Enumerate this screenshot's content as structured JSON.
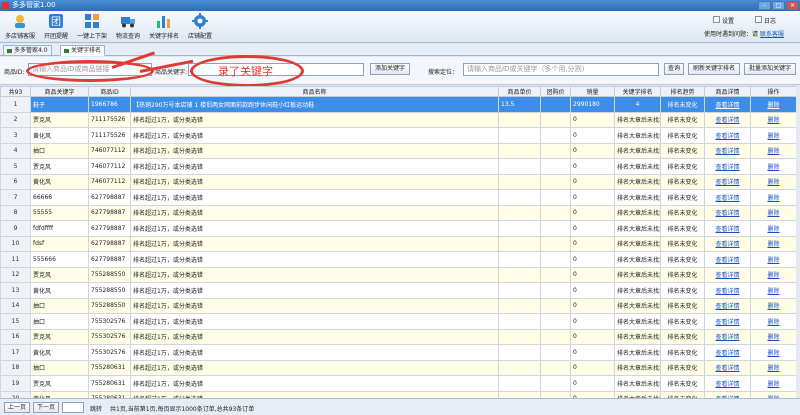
{
  "window": {
    "title": "多多管家1.00"
  },
  "toolbar": {
    "items": [
      {
        "label": "多店铺客服",
        "icon": "shop-service-icon"
      },
      {
        "label": "开团提醒",
        "icon": "group-buy-icon"
      },
      {
        "label": "一键上下架",
        "icon": "shelf-grid-icon"
      },
      {
        "label": "物流查询",
        "icon": "truck-icon"
      },
      {
        "label": "关键字排名",
        "icon": "bar-chart-icon"
      },
      {
        "label": "店铺配置",
        "icon": "gear-icon"
      }
    ],
    "settings_label": "设置",
    "log_label": "日志",
    "usage_text": "使用时遇到问题：请",
    "usage_link": "联系客服"
  },
  "tabs": [
    {
      "label": "多多管家4.0",
      "active": false
    },
    {
      "label": "关键字排名",
      "active": true
    }
  ],
  "search": {
    "product_id_label": "商品ID:",
    "product_id_placeholder": "请输入商品ID或商品链接",
    "keyword_label": "商品关键字:",
    "keyword_value": "",
    "add_keyword_button": "添加关键字",
    "search_locate_label": "搜索定位：",
    "search_placeholder": "请输入商品ID或关键字（多个用,分割)",
    "query_button": "查询",
    "refresh_rank_button": "刷新关键字排名",
    "batch_add_button": "批量添加关键字"
  },
  "annotation": {
    "text": "录了关键字"
  },
  "table": {
    "count_label": "共93",
    "columns": [
      "商品关键字",
      "商品ID",
      "商品名称",
      "商品单价",
      "团购价",
      "销量",
      "关键字排名",
      "排名趋势",
      "商品详情",
      "操作"
    ],
    "rows": [
      {
        "n": "1",
        "kw": "鞋子",
        "id": "1966786",
        "name": "【热销290万号本店铺 1 楼侣两女网面前款跑步休闲鞋小红板运动鞋",
        "price": "13.5",
        "group": "",
        "sales": "2990180",
        "rank": "4",
        "trend": "排名未变化",
        "detail": "查看详情",
        "op": "删除"
      },
      {
        "n": "2",
        "kw": "贾克风",
        "id": "711175526",
        "name": "排名超过1万，或分类选错",
        "price": "",
        "group": "",
        "sales": "0",
        "rank": "排名大章后未找到",
        "trend": "排名未变化",
        "detail": "查看详情",
        "op": "删除"
      },
      {
        "n": "3",
        "kw": "黄化风",
        "id": "711175526",
        "name": "排名超过1万，或分类选错",
        "price": "",
        "group": "",
        "sales": "0",
        "rank": "排名大章后未找到",
        "trend": "排名未变化",
        "detail": "查看详情",
        "op": "删除"
      },
      {
        "n": "4",
        "kw": "抽口",
        "id": "746077112",
        "name": "排名超过1万，或分类选错",
        "price": "",
        "group": "",
        "sales": "0",
        "rank": "排名大章后未找到",
        "trend": "排名未变化",
        "detail": "查看详情",
        "op": "删除"
      },
      {
        "n": "5",
        "kw": "贾克风",
        "id": "746077112",
        "name": "排名超过1万，或分类选错",
        "price": "",
        "group": "",
        "sales": "0",
        "rank": "排名大章后未找到",
        "trend": "排名未变化",
        "detail": "查看详情",
        "op": "删除"
      },
      {
        "n": "6",
        "kw": "黄化风",
        "id": "746077112",
        "name": "排名超过1万，或分类选错",
        "price": "",
        "group": "",
        "sales": "0",
        "rank": "排名大章后未找到",
        "trend": "排名未变化",
        "detail": "查看详情",
        "op": "删除"
      },
      {
        "n": "7",
        "kw": "66666",
        "id": "627798887",
        "name": "排名超过1万，或分类选错",
        "price": "",
        "group": "",
        "sales": "0",
        "rank": "排名大章后未找到",
        "trend": "排名未变化",
        "detail": "查看详情",
        "op": "删除"
      },
      {
        "n": "8",
        "kw": "55555",
        "id": "627798887",
        "name": "排名超过1万，或分类选错",
        "price": "",
        "group": "",
        "sales": "0",
        "rank": "排名大章后未找到",
        "trend": "排名未变化",
        "detail": "查看详情",
        "op": "删除"
      },
      {
        "n": "9",
        "kw": "fdfdffff",
        "id": "627798887",
        "name": "排名超过1万，或分类选错",
        "price": "",
        "group": "",
        "sales": "0",
        "rank": "排名大章后未找到",
        "trend": "排名未变化",
        "detail": "查看详情",
        "op": "删除"
      },
      {
        "n": "10",
        "kw": "fdsf",
        "id": "627798887",
        "name": "排名超过1万，或分类选错",
        "price": "",
        "group": "",
        "sales": "0",
        "rank": "排名大章后未找到",
        "trend": "排名未变化",
        "detail": "查看详情",
        "op": "删除"
      },
      {
        "n": "11",
        "kw": "555666",
        "id": "627798887",
        "name": "排名超过1万，或分类选错",
        "price": "",
        "group": "",
        "sales": "0",
        "rank": "排名大章后未找到",
        "trend": "排名未变化",
        "detail": "查看详情",
        "op": "删除"
      },
      {
        "n": "12",
        "kw": "贾克风",
        "id": "755288550",
        "name": "排名超过1万，或分类选错",
        "price": "",
        "group": "",
        "sales": "0",
        "rank": "排名大章后未找到",
        "trend": "排名未变化",
        "detail": "查看详情",
        "op": "删除"
      },
      {
        "n": "13",
        "kw": "黄化风",
        "id": "755288550",
        "name": "排名超过1万，或分类选错",
        "price": "",
        "group": "",
        "sales": "0",
        "rank": "排名大章后未找到",
        "trend": "排名未变化",
        "detail": "查看详情",
        "op": "删除"
      },
      {
        "n": "14",
        "kw": "抽口",
        "id": "755288550",
        "name": "排名超过1万，或分类选错",
        "price": "",
        "group": "",
        "sales": "0",
        "rank": "排名大章后未找到",
        "trend": "排名未变化",
        "detail": "查看详情",
        "op": "删除"
      },
      {
        "n": "15",
        "kw": "抽口",
        "id": "755302576",
        "name": "排名超过1万，或分类选错",
        "price": "",
        "group": "",
        "sales": "0",
        "rank": "排名大章后未找到",
        "trend": "排名未变化",
        "detail": "查看详情",
        "op": "删除"
      },
      {
        "n": "16",
        "kw": "贾克风",
        "id": "755302576",
        "name": "排名超过1万，或分类选错",
        "price": "",
        "group": "",
        "sales": "0",
        "rank": "排名大章后未找到",
        "trend": "排名未变化",
        "detail": "查看详情",
        "op": "删除"
      },
      {
        "n": "17",
        "kw": "黄化风",
        "id": "755302576",
        "name": "排名超过1万，或分类选错",
        "price": "",
        "group": "",
        "sales": "0",
        "rank": "排名大章后未找到",
        "trend": "排名未变化",
        "detail": "查看详情",
        "op": "删除"
      },
      {
        "n": "18",
        "kw": "抽口",
        "id": "755280631",
        "name": "排名超过1万，或分类选错",
        "price": "",
        "group": "",
        "sales": "0",
        "rank": "排名大章后未找到",
        "trend": "排名未变化",
        "detail": "查看详情",
        "op": "删除"
      },
      {
        "n": "19",
        "kw": "贾克风",
        "id": "755280631",
        "name": "排名超过1万，或分类选错",
        "price": "",
        "group": "",
        "sales": "0",
        "rank": "排名大章后未找到",
        "trend": "排名未变化",
        "detail": "查看详情",
        "op": "删除"
      },
      {
        "n": "20",
        "kw": "黄化风",
        "id": "755280631",
        "name": "排名超过1万，或分类选错",
        "price": "",
        "group": "",
        "sales": "0",
        "rank": "排名大章后未找到",
        "trend": "排名未变化",
        "detail": "查看详情",
        "op": "删除"
      }
    ]
  },
  "footer": {
    "prev_button": "上一页",
    "next_button": "下一页",
    "jump_button": "跳转",
    "summary": "共1页,当前第1页,每页显示1000条订单,总共93条订单"
  },
  "colors": {
    "accent": "#2d6bb8",
    "selected_row": "#3d8ee8",
    "even_row": "#fffde6",
    "annotation": "#e03a33",
    "link": "#1a4fc9"
  }
}
